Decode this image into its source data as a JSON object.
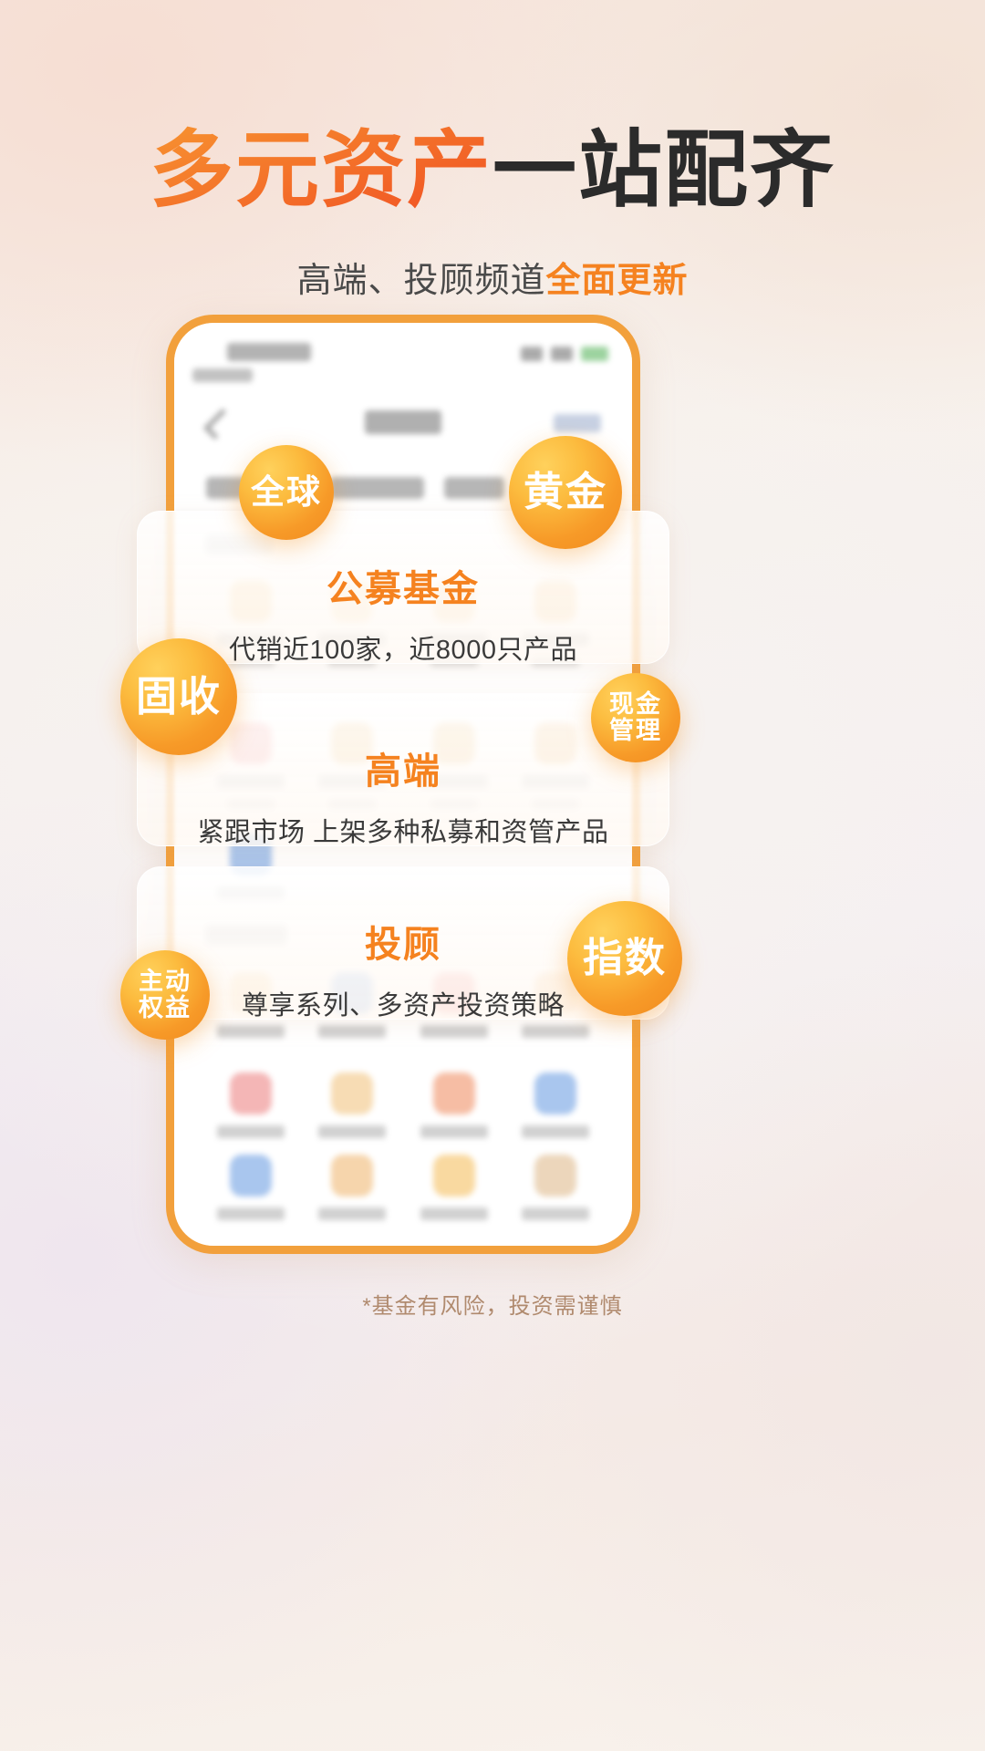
{
  "header": {
    "title_accent": "多元资产",
    "title_dark": "一站配齐",
    "subtitle_plain": "高端、投顾频道",
    "subtitle_accent": "全面更新"
  },
  "cards": [
    {
      "title": "公募基金",
      "desc": "代销近100家，近8000只产品"
    },
    {
      "title": "高端",
      "desc": "紧跟市场 上架多种私募和资管产品"
    },
    {
      "title": "投顾",
      "desc": "尊享系列、多资产投资策略"
    }
  ],
  "bubbles": [
    {
      "label": "全球",
      "name": "bubble-global"
    },
    {
      "label": "黄金",
      "name": "bubble-gold"
    },
    {
      "label": "固收",
      "name": "bubble-fixed-income"
    },
    {
      "label": "现金\n管理",
      "line1": "现金",
      "line2": "管理"
    },
    {
      "label": "指数",
      "name": "bubble-index"
    },
    {
      "label": "主动\n权益",
      "line1": "主动",
      "line2": "权益"
    }
  ],
  "footer": {
    "disclaimer": "*基金有风险，投资需谨慎"
  },
  "colors": {
    "accent_orange": "#f5821f",
    "title_gradient_start": "#f79431",
    "title_gradient_end": "#f04e23",
    "title_dark": "#2b2b2b",
    "bubble_gradient_light": "#ffd15c",
    "bubble_gradient_deep": "#f08a1e",
    "phone_border": "#f2a03c",
    "footer_text": "#b08a6e"
  }
}
